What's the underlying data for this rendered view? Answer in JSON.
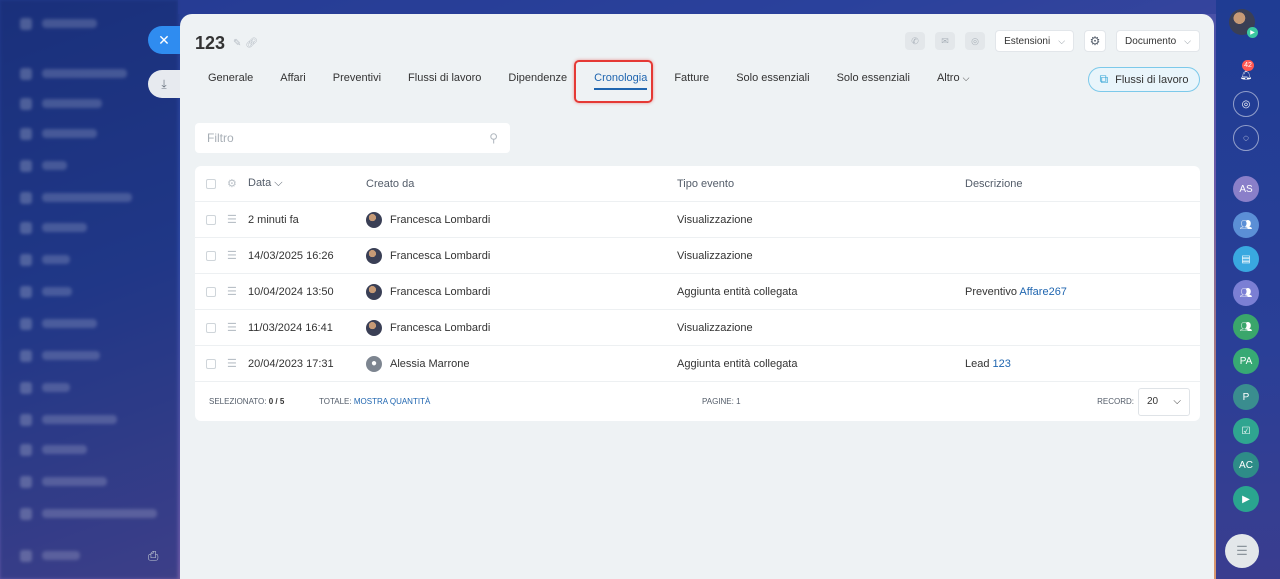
{
  "document": {
    "title": "123"
  },
  "header": {
    "extensions_label": "Estensioni",
    "document_label": "Documento"
  },
  "tabs": [
    {
      "label": "Generale"
    },
    {
      "label": "Affari"
    },
    {
      "label": "Preventivi"
    },
    {
      "label": "Flussi di lavoro"
    },
    {
      "label": "Dipendenze"
    },
    {
      "label": "Cronologia",
      "active": true
    },
    {
      "label": "Fatture"
    },
    {
      "label": "Solo essenziali"
    },
    {
      "label": "Solo essenziali"
    },
    {
      "label": "Altro"
    }
  ],
  "workflow_button": {
    "label": "Flussi di lavoro"
  },
  "filter": {
    "placeholder": "Filtro"
  },
  "grid": {
    "columns": {
      "date": "Data",
      "created_by": "Creato da",
      "event_type": "Tipo evento",
      "description": "Descrizione"
    },
    "rows": [
      {
        "date": "2 minuti fa",
        "user": "Francesca Lombardi",
        "event": "Visualizzazione",
        "desc_prefix": "",
        "desc_link": ""
      },
      {
        "date": "14/03/2025 16:26",
        "user": "Francesca Lombardi",
        "event": "Visualizzazione",
        "desc_prefix": "",
        "desc_link": ""
      },
      {
        "date": "10/04/2024 13:50",
        "user": "Francesca Lombardi",
        "event": "Aggiunta entità collegata",
        "desc_prefix": "Preventivo ",
        "desc_link": "Affare267"
      },
      {
        "date": "11/03/2024 16:41",
        "user": "Francesca Lombardi",
        "event": "Visualizzazione",
        "desc_prefix": "",
        "desc_link": ""
      },
      {
        "date": "20/04/2023 17:31",
        "user": "Alessia Marrone",
        "event": "Aggiunta entità collegata",
        "desc_prefix": "Lead ",
        "desc_link": "123"
      }
    ],
    "footer": {
      "selected_label": "SELEZIONATO:",
      "selected_value": "0 / 5",
      "total_label": "TOTALE:",
      "total_link": "MOSTRA QUANTITÀ",
      "pages_label": "PAGINE: 1",
      "records_label": "RECORD:",
      "records_value": "20"
    }
  },
  "rail": {
    "notifications_count": "42",
    "avatars": [
      "AS",
      "PA",
      "P",
      "AC"
    ]
  },
  "colors": {
    "accent": "#2066b0",
    "highlight": "#e53935",
    "close_button": "#2f8cf0"
  }
}
